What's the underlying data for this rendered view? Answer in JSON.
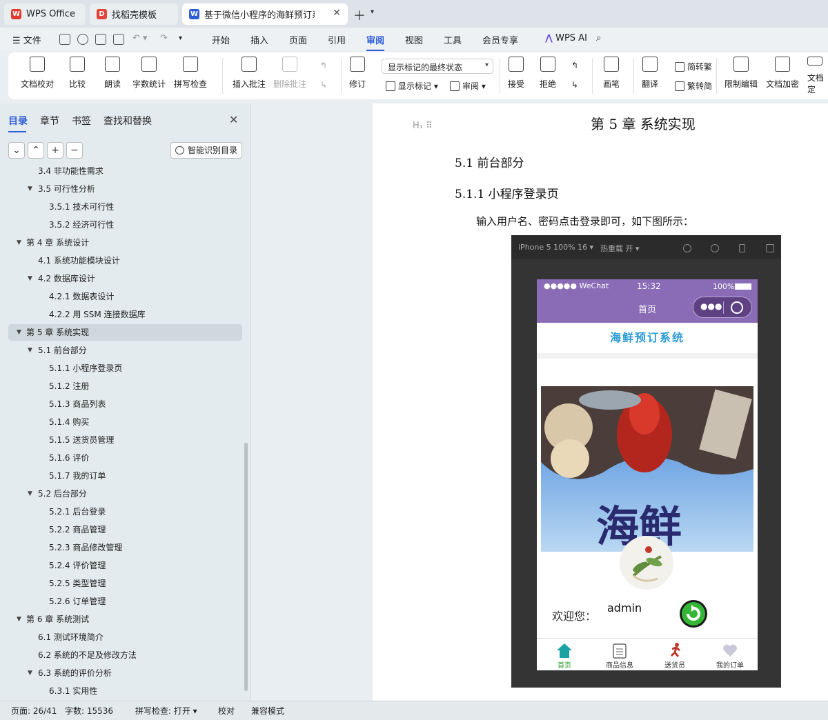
{
  "tabs": {
    "wps": "WPS Office",
    "template": "找稻壳模板",
    "doc": "基于微信小程序的海鲜预订系统"
  },
  "menu": {
    "file": "文件",
    "items": [
      "开始",
      "插入",
      "页面",
      "引用",
      "审阅",
      "视图",
      "工具",
      "会员专享"
    ],
    "active": "审阅",
    "wps_ai": "WPS AI"
  },
  "ribbon": {
    "doc_check": "文档校对",
    "compare": "比较",
    "read": "朗读",
    "word_count": "字数统计",
    "spell_check": "拼写检查",
    "insert_comment": "插入批注",
    "delete_comment": "删除批注",
    "revise": "修订",
    "markup_select": "显示标记的最终状态",
    "show_markup": "显示标记",
    "review": "审阅",
    "accept": "接受",
    "reject": "拒绝",
    "pen": "画笔",
    "translate": "翻译",
    "to_traditional": "简转繁",
    "to_simplified": "繁转简",
    "restrict_edit": "限制编辑",
    "encrypt": "文档加密",
    "doc_final": "文档定"
  },
  "sidebar": {
    "tabs": [
      "目录",
      "章节",
      "书签",
      "查找和替换"
    ],
    "smart_toc": "智能识别目录",
    "toc": [
      {
        "text": "3.4 非功能性需求",
        "level": 2,
        "arrow": ""
      },
      {
        "text": "3.5  可行性分析",
        "level": 2,
        "arrow": "▼"
      },
      {
        "text": "3.5.1  技术可行性",
        "level": 3,
        "arrow": ""
      },
      {
        "text": "3.5.2  经济可行性",
        "level": 3,
        "arrow": ""
      },
      {
        "text": "第 4 章  系统设计",
        "level": 1,
        "arrow": "▼"
      },
      {
        "text": "4.1 系统功能模块设计",
        "level": 2,
        "arrow": ""
      },
      {
        "text": "4.2 数据库设计",
        "level": 2,
        "arrow": "▼"
      },
      {
        "text": "4.2.1 数据表设计",
        "level": 3,
        "arrow": ""
      },
      {
        "text": "4.2.2 用 SSM 连接数据库",
        "level": 3,
        "arrow": ""
      },
      {
        "text": "第 5 章  系统实现",
        "level": 1,
        "arrow": "▼",
        "active": true
      },
      {
        "text": "5.1  前台部分",
        "level": 2,
        "arrow": "▼"
      },
      {
        "text": "5.1.1  小程序登录页",
        "level": 3,
        "arrow": ""
      },
      {
        "text": "5.1.2  注册",
        "level": 3,
        "arrow": ""
      },
      {
        "text": "5.1.3  商品列表",
        "level": 3,
        "arrow": ""
      },
      {
        "text": "5.1.4  购买",
        "level": 3,
        "arrow": ""
      },
      {
        "text": "5.1.5  送货员管理",
        "level": 3,
        "arrow": ""
      },
      {
        "text": "5.1.6  评价",
        "level": 3,
        "arrow": ""
      },
      {
        "text": "5.1.7  我的订单",
        "level": 3,
        "arrow": ""
      },
      {
        "text": "5.2  后台部分",
        "level": 2,
        "arrow": "▼"
      },
      {
        "text": "5.2.1  后台登录",
        "level": 3,
        "arrow": ""
      },
      {
        "text": "5.2.2  商品管理",
        "level": 3,
        "arrow": ""
      },
      {
        "text": "5.2.3  商品修改管理",
        "level": 3,
        "arrow": ""
      },
      {
        "text": "5.2.4  评价管理",
        "level": 3,
        "arrow": ""
      },
      {
        "text": "5.2.5  类型管理",
        "level": 3,
        "arrow": ""
      },
      {
        "text": "5.2.6  订单管理",
        "level": 3,
        "arrow": ""
      },
      {
        "text": "第 6 章  系统测试",
        "level": 1,
        "arrow": "▼"
      },
      {
        "text": "6.1  测试环境简介",
        "level": 2,
        "arrow": ""
      },
      {
        "text": "6.2  系统的不足及修改方法",
        "level": 2,
        "arrow": ""
      },
      {
        "text": "6.3  系统的评价分析",
        "level": 2,
        "arrow": "▼"
      },
      {
        "text": "6.3.1  实用性",
        "level": 3,
        "arrow": ""
      }
    ]
  },
  "document": {
    "chapter_title": "第 5 章  系统实现",
    "section": "5.1  前台部分",
    "subsection": "5.1.1  小程序登录页",
    "paragraph": "输入用户名、密码点击登录即可，如下图所示："
  },
  "devtools": {
    "device": "iPhone 5 100% 16 ▾",
    "hot_reload": "热重载 开 ▾"
  },
  "phone": {
    "carrier": "●●●●● WeChat",
    "time": "15:32",
    "battery": "100%",
    "nav_title": "首页",
    "app_title": "海鲜预订系统",
    "banner_text": "海鲜",
    "welcome": "欢迎您：",
    "username": "admin",
    "tabbar": [
      "首页",
      "商品信息",
      "送货员",
      "我的订单"
    ]
  },
  "statusbar": {
    "page": "页面: 26/41",
    "words": "字数: 15536",
    "spell": "拼写检查: 打开 ▾",
    "proof": "校对",
    "compat": "兼容模式"
  }
}
